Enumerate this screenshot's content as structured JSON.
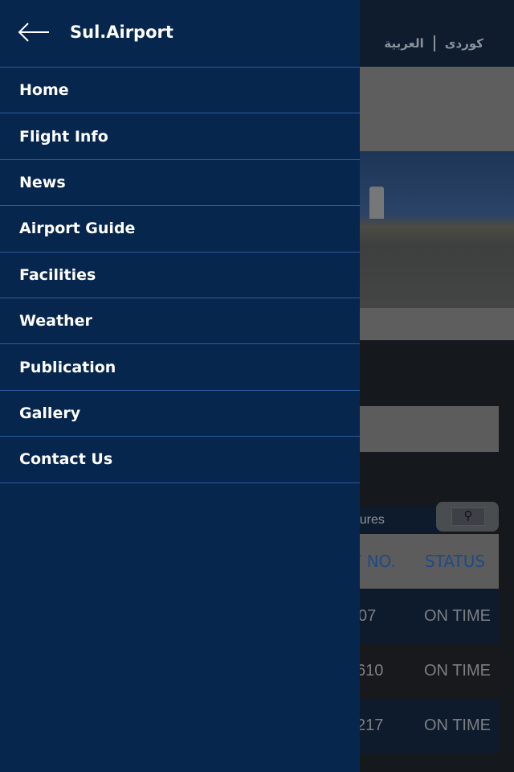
{
  "background": {
    "languages": [
      "کوردی",
      "العربية"
    ],
    "tab_partial": "rtures",
    "search_icon": "magnifier-icon",
    "table": {
      "headers": [
        "T NO.",
        "STATUS"
      ],
      "rows": [
        {
          "flight": "07",
          "status": "ON TIME"
        },
        {
          "flight": "610",
          "status": "ON TIME"
        },
        {
          "flight": "217",
          "status": "ON TIME"
        }
      ]
    }
  },
  "drawer": {
    "title": "Sul.Airport",
    "back_icon": "arrow-left-icon",
    "items": [
      {
        "label": "Home"
      },
      {
        "label": "Flight Info"
      },
      {
        "label": "News"
      },
      {
        "label": "Airport Guide"
      },
      {
        "label": "Facilities"
      },
      {
        "label": "Weather"
      },
      {
        "label": "Publication"
      },
      {
        "label": "Gallery"
      },
      {
        "label": "Contact Us"
      }
    ]
  },
  "colors": {
    "drawer": "#06264d",
    "divider": "#2c5aa0",
    "status_header": "#1f4a86"
  }
}
